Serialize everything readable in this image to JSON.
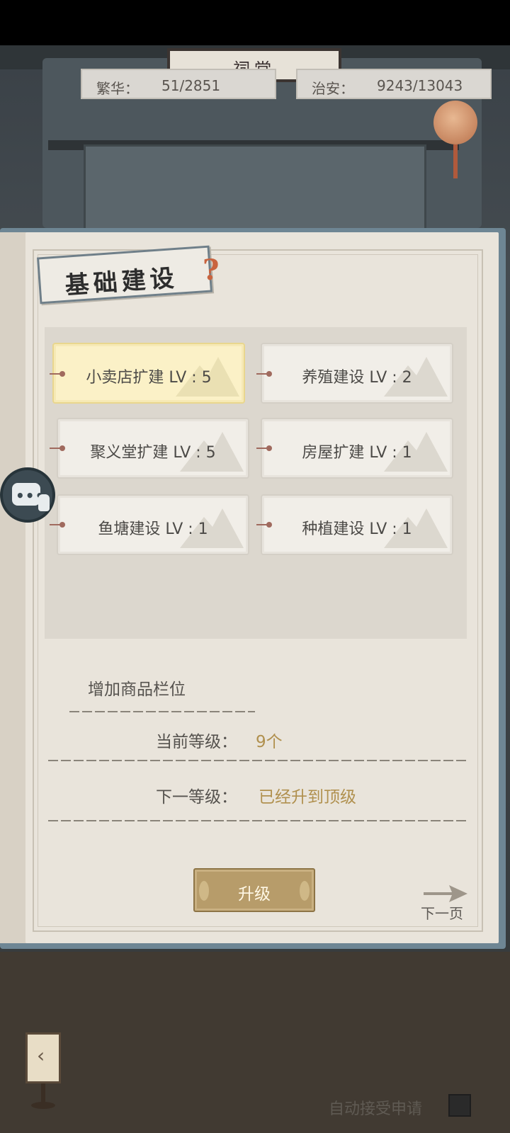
{
  "header": {
    "hall_sign": "祠堂",
    "prosperity_label": "繁华：",
    "prosperity_value": "51/2851",
    "security_label": "治安：",
    "security_value": "9243/13043"
  },
  "panel": {
    "title": "基础建设",
    "help_glyph": "?",
    "buildings": [
      {
        "label": "小卖店扩建 LV : 5",
        "selected": true
      },
      {
        "label": "养殖建设 LV : 2",
        "selected": false
      },
      {
        "label": "聚义堂扩建 LV : 5",
        "selected": false
      },
      {
        "label": "房屋扩建 LV : 1",
        "selected": false
      },
      {
        "label": "鱼塘建设 LV : 1",
        "selected": false
      },
      {
        "label": "种植建设 LV : 1",
        "selected": false
      }
    ]
  },
  "info": {
    "effect_title": "增加商品栏位",
    "current_level_label": "当前等级：",
    "current_level_value": "9个",
    "next_level_label": "下一等级：",
    "next_level_value": "已经升到顶级"
  },
  "actions": {
    "upgrade_label": "升级",
    "next_page_label": "下一页"
  },
  "footer": {
    "auto_accept_label": "自动接受申请",
    "auto_accept_checked": false
  },
  "icons": [
    "chat-icon",
    "help-icon",
    "arrow-right-icon",
    "lantern-icon",
    "back-icon"
  ],
  "colors": {
    "selected_card": "#fbf1c7",
    "accent_gold": "#b0904e",
    "button_gold": "#b79c6a",
    "help_orange": "#c9643f"
  }
}
